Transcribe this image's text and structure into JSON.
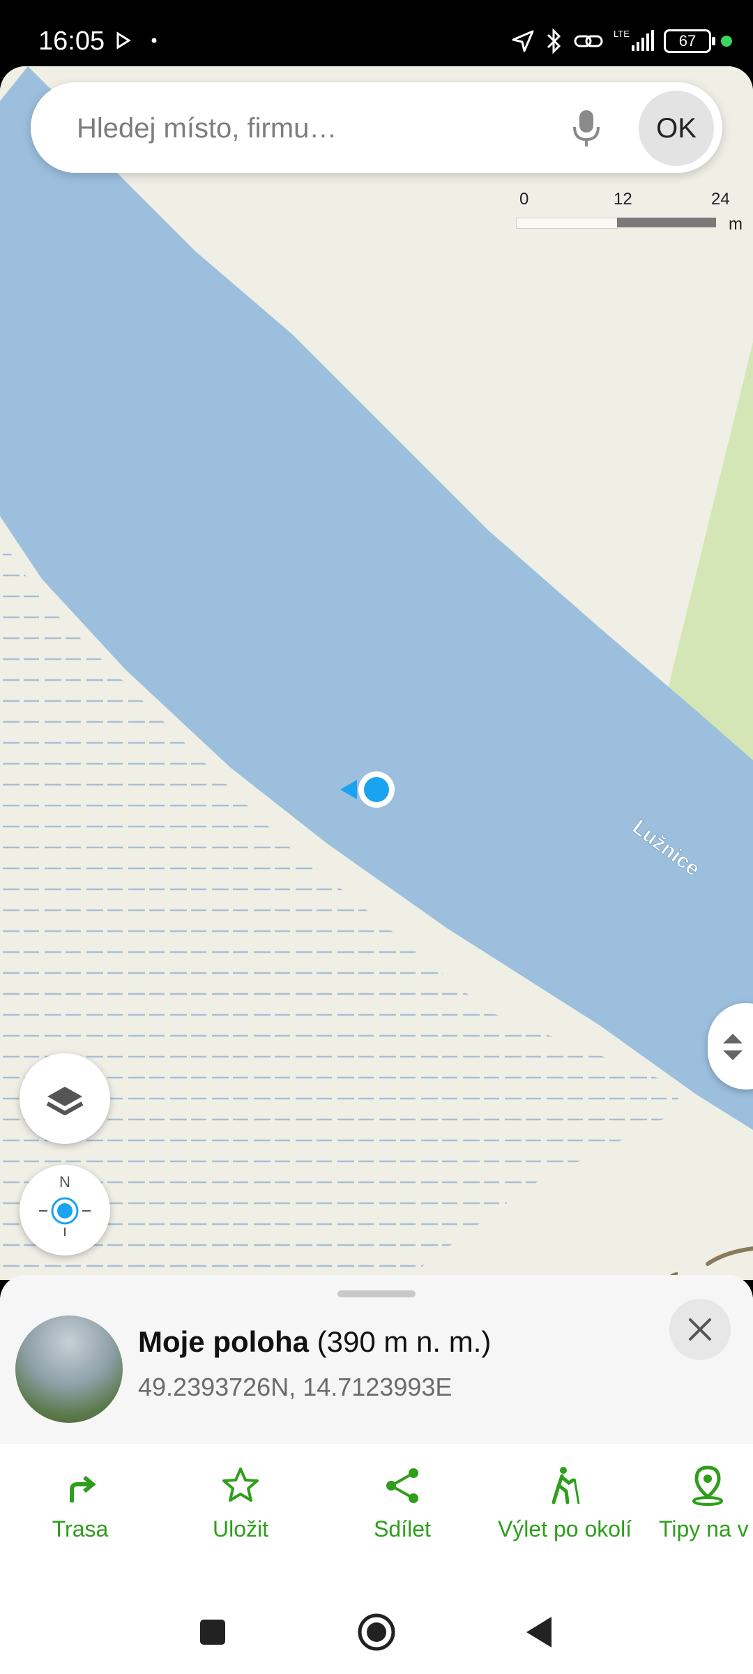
{
  "status_bar": {
    "time": "16:05",
    "battery": "67",
    "network": "LTE"
  },
  "search": {
    "placeholder": "Hledej místo, firmu…",
    "ok_label": "OK"
  },
  "scale": {
    "ticks": [
      "0",
      "12",
      "24"
    ],
    "unit": "m"
  },
  "map": {
    "river_label": "Lužnice",
    "compass_label": "N",
    "colors": {
      "water": "#9bbfdd",
      "land": "#efefe6",
      "meadow": "#d4e6b5",
      "wetland_dash": "#a9bfd3",
      "location": "#1aa3ef"
    }
  },
  "place_sheet": {
    "title_bold": "Moje poloha",
    "title_suffix": " (390 m n. m.)",
    "coords": "49.2393726N, 14.7123993E"
  },
  "actions": [
    {
      "label": "Trasa",
      "icon": "route-arrow-icon"
    },
    {
      "label": "Uložit",
      "icon": "star-icon"
    },
    {
      "label": "Sdílet",
      "icon": "share-icon"
    },
    {
      "label": "Výlet po okolí",
      "icon": "hiker-icon"
    },
    {
      "label": "Tipy na v",
      "icon": "map-pin-icon"
    }
  ],
  "accent_color": "#2e9e1b"
}
